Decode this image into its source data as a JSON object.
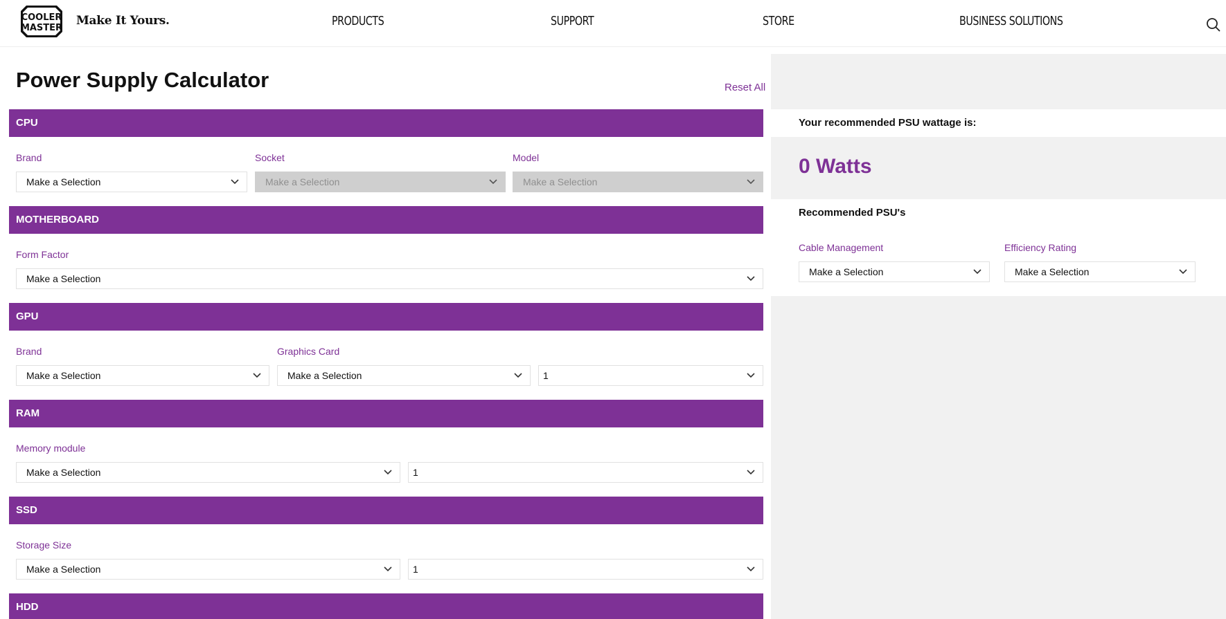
{
  "header": {
    "logo_text": "COOLER MASTER",
    "tagline": "Make It Yours.",
    "nav": [
      "PRODUCTS",
      "SUPPORT",
      "STORE",
      "BUSINESS SOLUTIONS"
    ],
    "icons": {
      "search": "search-icon"
    }
  },
  "page": {
    "title": "Power Supply Calculator",
    "reset": "Reset All"
  },
  "cpu": {
    "heading": "CPU",
    "brand_label": "Brand",
    "brand_value": "Make a Selection",
    "socket_label": "Socket",
    "socket_value": "Make a Selection",
    "model_label": "Model",
    "model_value": "Make a Selection"
  },
  "motherboard": {
    "heading": "MOTHERBOARD",
    "form_factor_label": "Form Factor",
    "form_factor_value": "Make a Selection"
  },
  "gpu": {
    "heading": "GPU",
    "brand_label": "Brand",
    "brand_value": "Make a Selection",
    "card_label": "Graphics Card",
    "card_value": "Make a Selection",
    "qty_value": "1"
  },
  "ram": {
    "heading": "RAM",
    "module_label": "Memory module",
    "module_value": "Make a Selection",
    "qty_value": "1"
  },
  "ssd": {
    "heading": "SSD",
    "size_label": "Storage Size",
    "size_value": "Make a Selection",
    "qty_value": "1"
  },
  "hdd": {
    "heading": "HDD"
  },
  "result": {
    "recommended_label": "Your recommended PSU wattage is:",
    "watts": "0 Watts",
    "psus_label": "Recommended PSU's",
    "cable_label": "Cable Management",
    "cable_value": "Make a Selection",
    "efficiency_label": "Efficiency Rating",
    "efficiency_value": "Make a Selection"
  },
  "colors": {
    "accent": "#7e3196",
    "panel_bg": "#f1f1f1",
    "disabled_bg": "#cfcfcf"
  }
}
